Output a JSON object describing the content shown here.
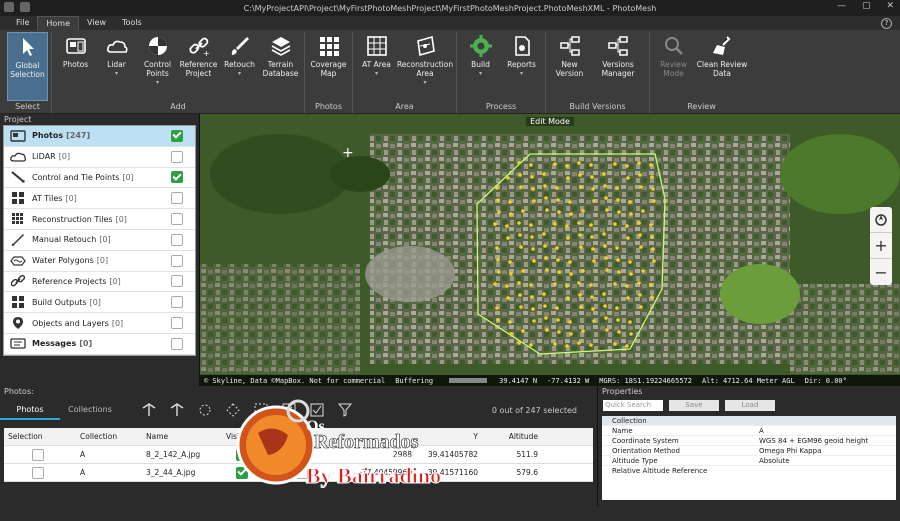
{
  "window": {
    "title": "C:\\MyProjectAPI\\Project\\MyFirstPhotoMeshProject\\MyFirstPhotoMeshProject.PhotoMeshXML - PhotoMesh",
    "min": "—",
    "max": "▢",
    "close": "✕"
  },
  "menu": {
    "file": "File",
    "home": "Home",
    "view": "View",
    "tools": "Tools",
    "help": "?"
  },
  "ribbon": {
    "select": {
      "label": "Select",
      "global": "Global Selection"
    },
    "add": {
      "label": "Add",
      "photos": "Photos",
      "lidar": "Lidar",
      "control_points": "Control Points",
      "reference_project": "Reference Project",
      "retouch": "Retouch",
      "terrain_database": "Terrain Database"
    },
    "photos_group": {
      "label": "Photos",
      "coverage_map": "Coverage Map"
    },
    "area": {
      "label": "Area",
      "at_area": "AT Area",
      "reconstruction_area": "Reconstruction Area"
    },
    "process": {
      "label": "Process",
      "build": "Build",
      "reports": "Reports"
    },
    "build_versions": {
      "label": "Build Versions",
      "new_version": "New Version",
      "versions_manager": "Versions Manager"
    },
    "review": {
      "label": "Review",
      "review_mode": "Review Mode",
      "clean_review": "Clean Review Data"
    }
  },
  "project": {
    "title": "Project",
    "items": [
      {
        "label": "Photos",
        "count": "[247]",
        "checked": true,
        "selected": true,
        "bold": true
      },
      {
        "label": "LiDAR",
        "count": "[0]",
        "checked": false
      },
      {
        "label": "Control and Tie Points",
        "count": "[0]",
        "checked": true
      },
      {
        "label": "AT Tiles",
        "count": "[0]",
        "checked": false
      },
      {
        "label": "Reconstruction Tiles",
        "count": "[0]",
        "checked": false
      },
      {
        "label": "Manual Retouch",
        "count": "[0]",
        "checked": false
      },
      {
        "label": "Water Polygons",
        "count": "[0]",
        "checked": false
      },
      {
        "label": "Reference Projects",
        "count": "[0]",
        "checked": false
      },
      {
        "label": "Build Outputs",
        "count": "[0]",
        "checked": false
      },
      {
        "label": "Objects and Layers",
        "count": "[0]",
        "checked": false
      },
      {
        "label": "Messages",
        "count": "[0]",
        "checked": false,
        "bold": true
      }
    ]
  },
  "map": {
    "edit_mode": "Edit Mode",
    "zoom_in": "+",
    "zoom_out": "−",
    "status": {
      "credits": "© Skyline, Data ©MapBox. Not for commercial",
      "buffering": "Buffering",
      "lat": "39.4147 N",
      "lon": "-77.4132 W",
      "mgrs": "MGRS: 18S1.19224665572",
      "alt": "Alt: 4712.64 Meter AGL",
      "dir": "Dir: 0.00°"
    }
  },
  "photos_panel": {
    "title": "Photos:",
    "tab_photos": "Photos",
    "tab_collections": "Collections",
    "count": "0 out of 247 selected",
    "columns": [
      "Selection",
      "Collection",
      "Name",
      "Visible",
      "Pi",
      "",
      "Y",
      "Altitude"
    ],
    "rows": [
      {
        "collection": "A",
        "name": "8_2_142_A.jpg",
        "x": "2988",
        "y": "39.41405782",
        "alt": "511.9"
      },
      {
        "collection": "A",
        "name": "3_2_44_A.jpg",
        "x": "-77.40459960",
        "y": "39.41571160",
        "alt": "579.6"
      }
    ]
  },
  "properties": {
    "title": "Properties",
    "search": "Quick Search",
    "save": "Save",
    "load": "Load",
    "group": "Collection",
    "rows": [
      {
        "k": "Name",
        "v": "A"
      },
      {
        "k": "Coordinate System",
        "v": "WGS 84 + EGM96 geoid height"
      },
      {
        "k": "Orientation Method",
        "v": "Omega Phi Kappa"
      },
      {
        "k": "Altitude Type",
        "v": "Absolute"
      },
      {
        "k": "Relative Altitude Reference",
        "v": ""
      }
    ]
  },
  "watermark": {
    "line1": "Os",
    "line2": "Reformados",
    "line3": "Da Investigação",
    "line4": "By Bairradino"
  },
  "colors": {
    "accent": "#2aa9e0",
    "check": "#2ea043",
    "ribbon": "#3c3c3c",
    "polygon": "#c8ff6a",
    "points": "#f2d21a"
  }
}
